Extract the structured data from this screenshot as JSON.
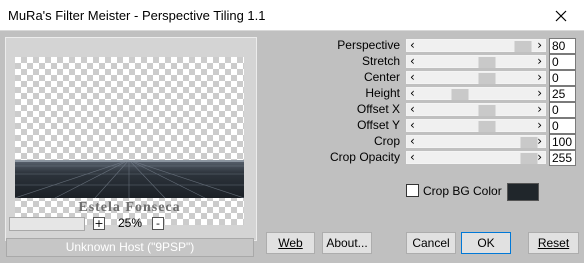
{
  "window": {
    "title": "MuRa's Filter Meister - Perspective Tiling 1.1"
  },
  "preview": {
    "signature": "Estela Fonseca",
    "zoom_minus": "-",
    "zoom_plus": "+",
    "zoom_value": "25%",
    "host_text": "Unknown Host (\"9PSP\")"
  },
  "params": [
    {
      "label": "Perspective",
      "value": "80",
      "level": 0.94
    },
    {
      "label": "Stretch",
      "value": "0",
      "level": 0.6
    },
    {
      "label": "Center",
      "value": "0",
      "level": 0.6
    },
    {
      "label": "Height",
      "value": "25",
      "level": 0.35
    },
    {
      "label": "Offset X",
      "value": "0",
      "level": 0.6
    },
    {
      "label": "Offset Y",
      "value": "0",
      "level": 0.6
    },
    {
      "label": "Crop",
      "value": "100",
      "level": 1.0
    },
    {
      "label": "Crop Opacity",
      "value": "255",
      "level": 1.0
    }
  ],
  "crop_bg": {
    "label": "Crop BG Color",
    "checked": false,
    "color": "#20262b"
  },
  "buttons": {
    "web": "Web",
    "about": "About...",
    "cancel": "Cancel",
    "ok": "OK",
    "reset": "Reset"
  },
  "icons": {
    "close": "close-icon",
    "left_arrow": "arrow-left-icon",
    "right_arrow": "arrow-right-icon"
  }
}
